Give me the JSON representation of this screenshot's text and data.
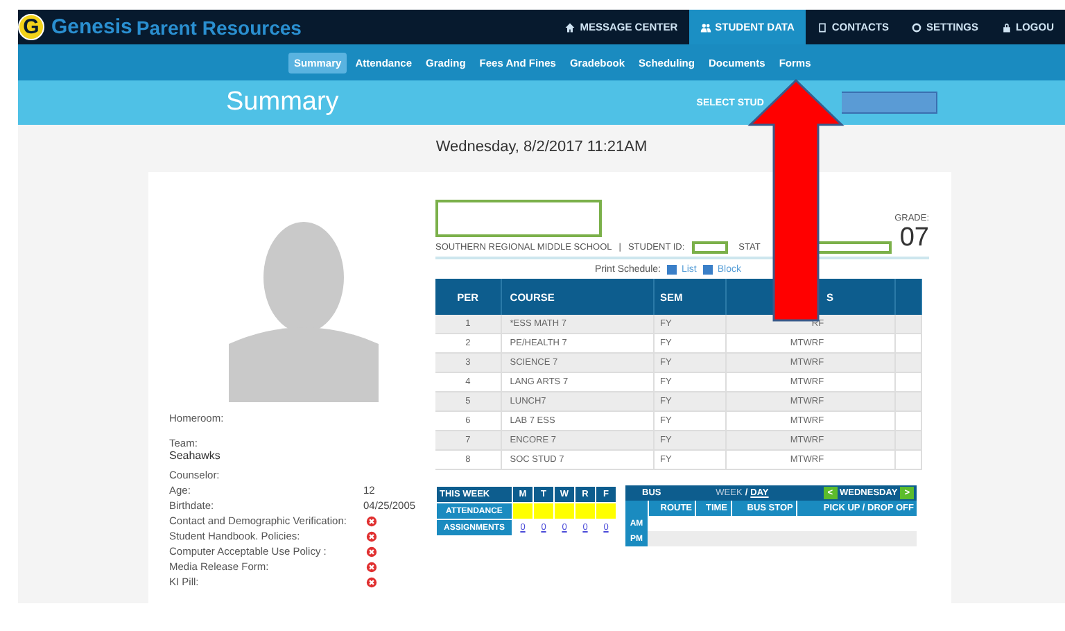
{
  "header": {
    "logo_letter": "G",
    "brand": "Genesis",
    "subtitle": "Parent Resources",
    "nav": [
      {
        "label": "MESSAGE CENTER",
        "selected": false
      },
      {
        "label": "STUDENT DATA",
        "selected": true
      },
      {
        "label": "CONTACTS",
        "selected": false
      },
      {
        "label": "SETTINGS",
        "selected": false
      },
      {
        "label": "LOGOU",
        "selected": false
      }
    ]
  },
  "subnav": [
    {
      "label": "Summary",
      "selected": true
    },
    {
      "label": "Attendance",
      "selected": false
    },
    {
      "label": "Grading",
      "selected": false
    },
    {
      "label": "Fees And Fines",
      "selected": false
    },
    {
      "label": "Gradebook",
      "selected": false
    },
    {
      "label": "Scheduling",
      "selected": false
    },
    {
      "label": "Documents",
      "selected": false
    },
    {
      "label": "Forms",
      "selected": false
    }
  ],
  "page_title": "Summary",
  "student_select_label": "SELECT STUD",
  "date": "Wednesday, 8/2/2017 11:21AM",
  "profile": [
    {
      "kind": "text",
      "label": "Homeroom:"
    },
    {
      "kind": "stacked",
      "label": "Team:",
      "value": "Seahawks"
    },
    {
      "kind": "text",
      "label": "Counselor:"
    },
    {
      "kind": "text",
      "label": "Age:",
      "value": "12"
    },
    {
      "kind": "text",
      "label": "Birthdate:",
      "value": "04/25/2005"
    },
    {
      "kind": "status",
      "label": "Contact and Demographic Verification:",
      "complete": false
    },
    {
      "kind": "status",
      "label": "Student Handbook. Policies:",
      "complete": false
    },
    {
      "kind": "status",
      "label": "Computer Acceptable Use Policy :",
      "complete": false
    },
    {
      "kind": "status",
      "label": "Media Release Form:",
      "complete": false
    },
    {
      "kind": "status",
      "label": "KI Pill:",
      "complete": false
    }
  ],
  "school": "SOUTHERN REGIONAL MIDDLE SCHOOL",
  "separator": "|",
  "student_id_label": "STUDENT ID:",
  "state_id_label": "STAT",
  "grade_label": "GRADE:",
  "grade": "07",
  "print_schedule": {
    "label": "Print Schedule:",
    "links": [
      "List",
      "Block"
    ]
  },
  "schedule": {
    "columns": [
      "PER",
      "COURSE",
      "SEM",
      "S"
    ],
    "rows": [
      [
        "1",
        "*ESS MATH 7",
        "FY",
        "RF"
      ],
      [
        "2",
        "PE/HEALTH 7",
        "FY",
        "MTWRF"
      ],
      [
        "3",
        "SCIENCE 7",
        "FY",
        "MTWRF"
      ],
      [
        "4",
        "LANG ARTS 7",
        "FY",
        "MTWRF"
      ],
      [
        "5",
        "LUNCH7",
        "FY",
        "MTWRF"
      ],
      [
        "6",
        "LAB 7 ESS",
        "FY",
        "MTWRF"
      ],
      [
        "7",
        "ENCORE 7",
        "FY",
        "MTWRF"
      ],
      [
        "8",
        "SOC STUD 7",
        "FY",
        "MTWRF"
      ]
    ]
  },
  "this_week": {
    "title": "THIS WEEK",
    "days": [
      "M",
      "T",
      "W",
      "R",
      "F"
    ],
    "rows": [
      {
        "kind": "attendance",
        "label": "ATTENDANCE"
      },
      {
        "kind": "assignments",
        "label": "ASSIGNMENTS",
        "values": [
          "0",
          "0",
          "0",
          "0",
          "0"
        ]
      }
    ]
  },
  "bus": {
    "title": "BUS",
    "views": [
      {
        "label": "WEEK",
        "selected": false
      },
      {
        "label": "DAY",
        "selected": true
      }
    ],
    "view_separator": "/",
    "prev": "<",
    "day": "WEDNESDAY",
    "next": ">",
    "columns": [
      "ROUTE",
      "TIME",
      "BUS STOP",
      "PICK UP / DROP OFF"
    ],
    "rows": [
      "AM",
      "PM"
    ]
  }
}
